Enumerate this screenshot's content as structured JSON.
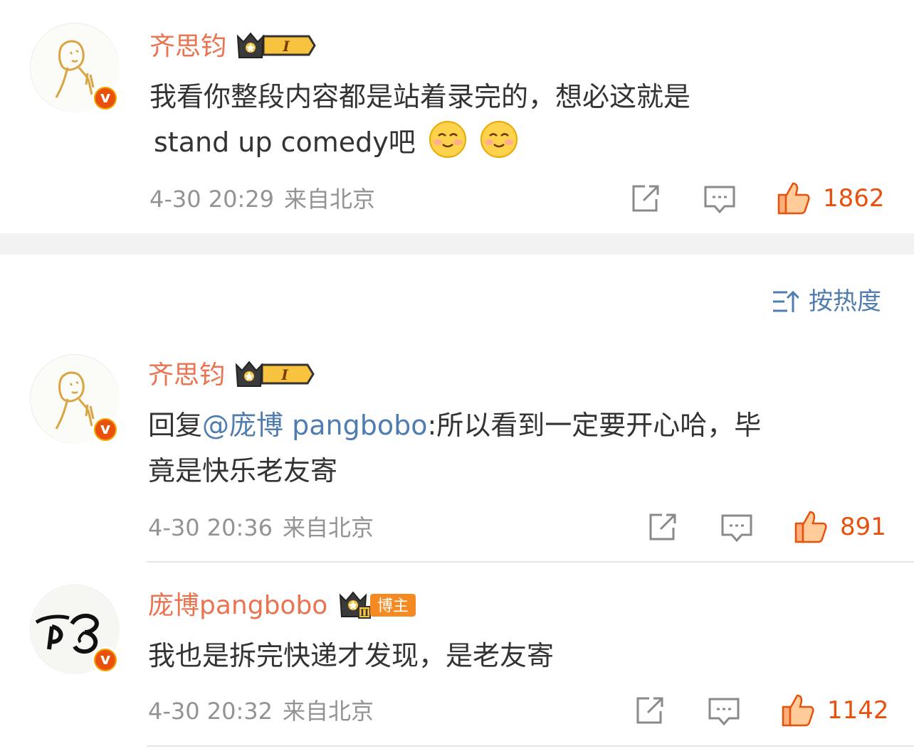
{
  "comments": [
    {
      "username": "齐思钧",
      "level_badge": "I",
      "text_line1": "我看你整段内容都是站着录完的，想必这就是",
      "text_line2": "stand up comedy吧",
      "emojis": [
        "smile-emoji",
        "smile-emoji"
      ],
      "time": "4-30 20:29",
      "source": "来自北京",
      "likes": "1862"
    },
    {
      "username": "齐思钧",
      "level_badge": "I",
      "reply_prefix": "回复",
      "mention": "@庞博 pangbobo",
      "text_line1_rest": ":所以看到一定要开心哈，毕",
      "text_line2": "竟是快乐老友寄",
      "time": "4-30 20:36",
      "source": "来自北京",
      "likes": "891"
    },
    {
      "username": "庞博pangbobo",
      "level_badge": "II",
      "role_badge": "博主",
      "text_line1": "我也是拆完快递才发现，是老友寄",
      "time": "4-30 20:32",
      "source": "来自北京",
      "likes": "1142"
    }
  ],
  "sort": {
    "label": "按热度"
  },
  "colors": {
    "username": "#eb7350",
    "mention": "#507daf",
    "like": "#e9500c",
    "meta": "#939393"
  }
}
